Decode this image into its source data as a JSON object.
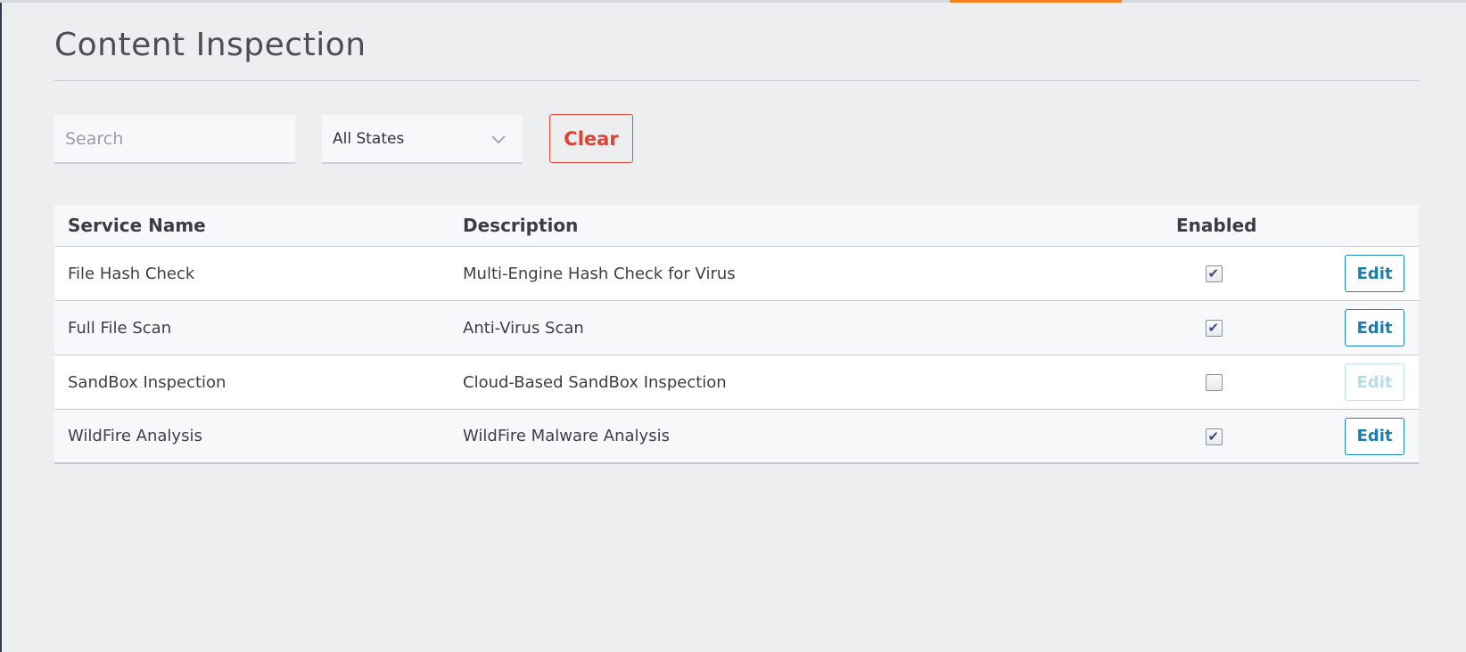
{
  "page": {
    "title": "Content Inspection"
  },
  "filters": {
    "search_placeholder": "Search",
    "state_value": "All States",
    "clear_label": "Clear"
  },
  "table": {
    "headers": {
      "service_name": "Service Name",
      "description": "Description",
      "enabled": "Enabled"
    },
    "rows": [
      {
        "service_name": "File Hash Check",
        "description": "Multi-Engine Hash Check for Virus",
        "enabled": true,
        "action_label": "Edit",
        "action_enabled": true
      },
      {
        "service_name": "Full File Scan",
        "description": "Anti-Virus Scan",
        "enabled": true,
        "action_label": "Edit",
        "action_enabled": true
      },
      {
        "service_name": "SandBox Inspection",
        "description": "Cloud-Based SandBox Inspection",
        "enabled": false,
        "action_label": "Edit",
        "action_enabled": false
      },
      {
        "service_name": "WildFire Analysis",
        "description": "WildFire Malware Analysis",
        "enabled": true,
        "action_label": "Edit",
        "action_enabled": true
      }
    ]
  },
  "colors": {
    "accent_orange": "#f5821f",
    "clear_red": "#de4234",
    "edit_blue": "#1a7eb0"
  },
  "icons": {
    "select_chevron": "chevron-down-icon",
    "checkbox_checked": "checkbox-checked-icon"
  }
}
